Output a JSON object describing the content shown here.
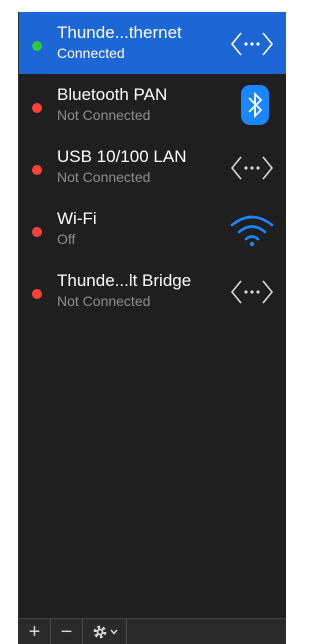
{
  "services": [
    {
      "name": "Thunde...thernet",
      "status": "Connected",
      "status_color": "#2bc840",
      "icon": "ethernet-arrows-icon",
      "selected": true
    },
    {
      "name": "Bluetooth PAN",
      "status": "Not Connected",
      "status_color": "#ff4136",
      "icon": "bluetooth-icon",
      "selected": false
    },
    {
      "name": "USB 10/100 LAN",
      "status": "Not Connected",
      "status_color": "#ff4136",
      "icon": "ethernet-arrows-icon",
      "selected": false
    },
    {
      "name": "Wi-Fi",
      "status": "Off",
      "status_color": "#ff4136",
      "icon": "wifi-icon",
      "selected": false
    },
    {
      "name": "Thunde...lt Bridge",
      "status": "Not Connected",
      "status_color": "#ff4136",
      "icon": "ethernet-arrows-icon",
      "selected": false
    }
  ],
  "toolbar": {
    "add_label": "+",
    "remove_label": "−",
    "action_icon": "gear-icon"
  },
  "colors": {
    "selection": "#1d66d6",
    "panel_background": "#1f1f1f",
    "connected": "#2bc840",
    "not_connected": "#ff4136",
    "wifi": "#1a86ff"
  }
}
